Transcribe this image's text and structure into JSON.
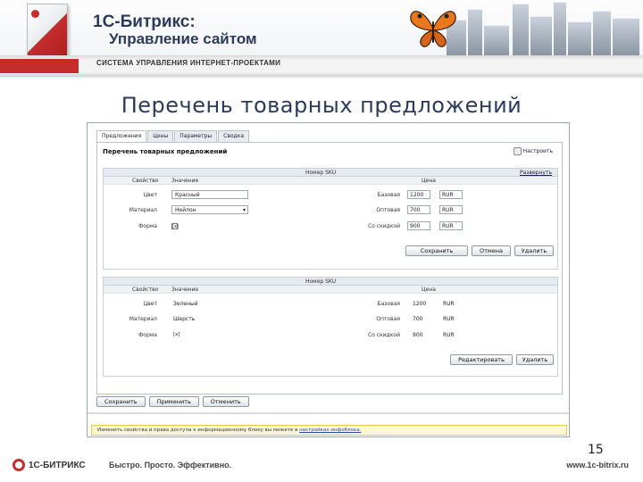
{
  "banner": {
    "brand": "1С-Битрикс:",
    "product": "Управление сайтом",
    "tagline": "СИСТЕМА УПРАВЛЕНИЯ ИНТЕРНЕТ-ПРОЕКТАМИ"
  },
  "title": "Перечень товарных предложений",
  "screenshot": {
    "tabs": [
      "Предложения",
      "Цены",
      "Параметры",
      "Сводка"
    ],
    "panel_title": "Перечень товарных предложений",
    "settings_label": "Настроить",
    "sku_header": "Номер SKU",
    "expand_label": "Развернуть",
    "col_property": "Свойство",
    "col_value": "Значение",
    "col_price": "Цена",
    "sku1": {
      "props": [
        {
          "label": "Цвет",
          "value": "Красный"
        },
        {
          "label": "Материал",
          "value": "Нейлон"
        },
        {
          "label": "Форма",
          "value": "[x]"
        }
      ],
      "prices": [
        {
          "label": "Базовая",
          "value": "1200",
          "currency": "RUR"
        },
        {
          "label": "Оптовая",
          "value": "700",
          "currency": "RUR"
        },
        {
          "label": "Со скидкой",
          "value": "900",
          "currency": "RUR"
        }
      ],
      "buttons": {
        "save": "Сохранить",
        "cancel": "Отмена",
        "delete": "Удалить"
      }
    },
    "sku2": {
      "props": [
        {
          "label": "Цвет",
          "value": "Зеленый"
        },
        {
          "label": "Материал",
          "value": "Шерсть"
        },
        {
          "label": "Форма",
          "value": "[x]"
        }
      ],
      "prices": [
        {
          "label": "Базовая",
          "value": "1200",
          "currency": "RUR"
        },
        {
          "label": "Оптовая",
          "value": "700",
          "currency": "RUR"
        },
        {
          "label": "Со скидкой",
          "value": "900",
          "currency": "RUR"
        }
      ],
      "buttons": {
        "edit": "Редактировать",
        "delete": "Удалить"
      }
    },
    "bottom_buttons": {
      "save": "Сохранить",
      "apply": "Применить",
      "cancel": "Отменить"
    },
    "notice_text": "Изменить свойства и права доступа к информационному блоку вы можете в",
    "notice_link": "настройках инфоблока."
  },
  "page_number": "15",
  "footer": {
    "logo": "1С-БИТРИКС",
    "slogan": "Быстро. Просто. Эффективно.",
    "url": "www.1c-bitrix.ru"
  },
  "colors": {
    "accent": "#c62c2c",
    "title": "#2d3b5a"
  }
}
